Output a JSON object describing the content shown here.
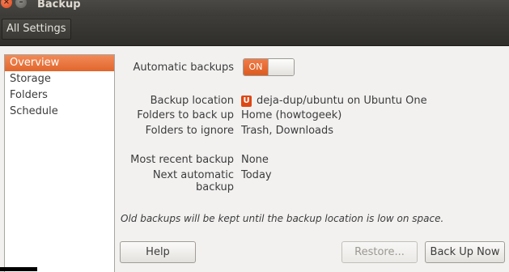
{
  "window": {
    "title": "Backup"
  },
  "toolbar": {
    "all_settings_label": "All Settings"
  },
  "sidebar": {
    "items": [
      {
        "label": "Overview",
        "selected": true
      },
      {
        "label": "Storage"
      },
      {
        "label": "Folders"
      },
      {
        "label": "Schedule"
      }
    ]
  },
  "overview": {
    "automatic_backups_label": "Automatic backups",
    "toggle_state": "ON",
    "backup_location_label": "Backup location",
    "backup_location_icon_text": "U",
    "backup_location_value": "deja-dup/ubuntu on Ubuntu One",
    "folders_backup_label": "Folders to back up",
    "folders_backup_value": "Home (howtogeek)",
    "folders_ignore_label": "Folders to ignore",
    "folders_ignore_value": "Trash, Downloads",
    "recent_backup_label": "Most recent backup",
    "recent_backup_value": "None",
    "next_backup_label": "Next automatic backup",
    "next_backup_value": "Today",
    "note": "Old backups will be kept until the backup location is low on space."
  },
  "buttons": {
    "help": "Help",
    "restore": "Restore...",
    "backup_now": "Back Up Now"
  },
  "colors": {
    "accent": "#dd4814",
    "selected": "#e96a33"
  }
}
